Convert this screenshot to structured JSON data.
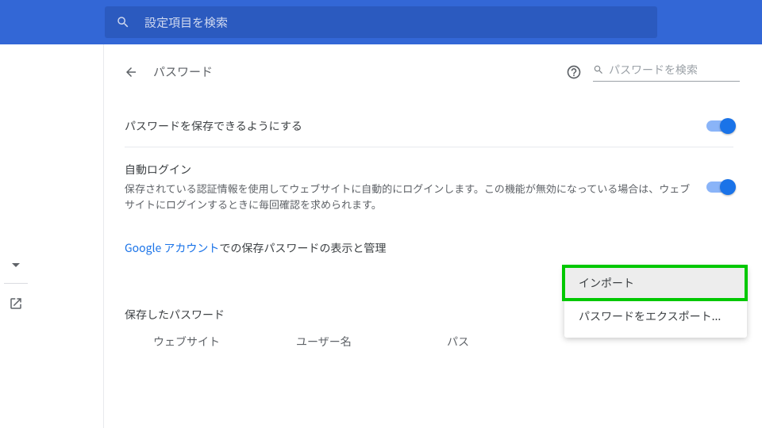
{
  "topbar": {
    "search_placeholder": "設定項目を検索"
  },
  "header": {
    "page_title": "パスワード",
    "password_search_placeholder": "パスワードを検索"
  },
  "rows": {
    "offer_save": {
      "label": "パスワードを保存できるようにする"
    },
    "auto_signin": {
      "title": "自動ログイン",
      "desc": "保存されている認証情報を使用してウェブサイトに自動的にログインします。この機能が無効になっている場合は、ウェブサイトにログインするときに毎回確認を求められます。"
    }
  },
  "account_link": {
    "link_text": "Google アカウント",
    "suffix": "での保存パスワードの表示と管理"
  },
  "saved": {
    "header_label": "保存したパスワード",
    "col_site": "ウェブサイト",
    "col_user": "ユーザー名",
    "col_pwd": "パス"
  },
  "menu": {
    "import": "インポート",
    "export": "パスワードをエクスポート..."
  }
}
